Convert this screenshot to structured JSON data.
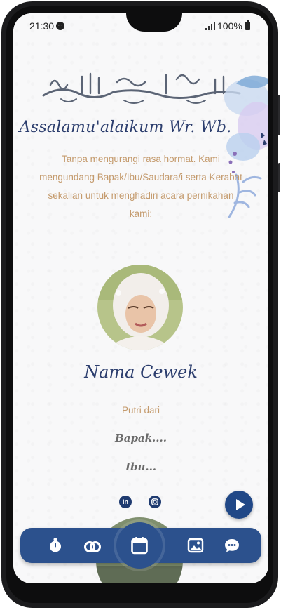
{
  "status_bar": {
    "time": "21:30",
    "battery": "100%"
  },
  "bismillah_text": "بسم الله الرحمن الرحيم",
  "greeting": "Assalamu'alaikum Wr. Wb.",
  "intro": "Tanpa mengurangi rasa hormat. Kami mengundang Bapak/Ibu/Saudara/i serta Kerabat sekalian untuk menghadiri acara pernikahan kami:",
  "bride": {
    "name": "Nama Cewek",
    "child_of": "Putri dari",
    "father": "Bapak....",
    "mother": "Ibu..."
  },
  "social": [
    {
      "icon": "linkedin-icon",
      "label": "in"
    },
    {
      "icon": "instagram-icon",
      "label": ""
    }
  ],
  "nav": [
    {
      "name": "countdown",
      "icon": "stopwatch-icon"
    },
    {
      "name": "couple",
      "icon": "rings-icon"
    },
    {
      "name": "event",
      "icon": "calendar-icon"
    },
    {
      "name": "gallery",
      "icon": "image-icon"
    },
    {
      "name": "wishes",
      "icon": "chat-icon"
    }
  ],
  "colors": {
    "accent": "#2c518d",
    "title": "#2c3e6e",
    "gold": "#c49a6c"
  }
}
